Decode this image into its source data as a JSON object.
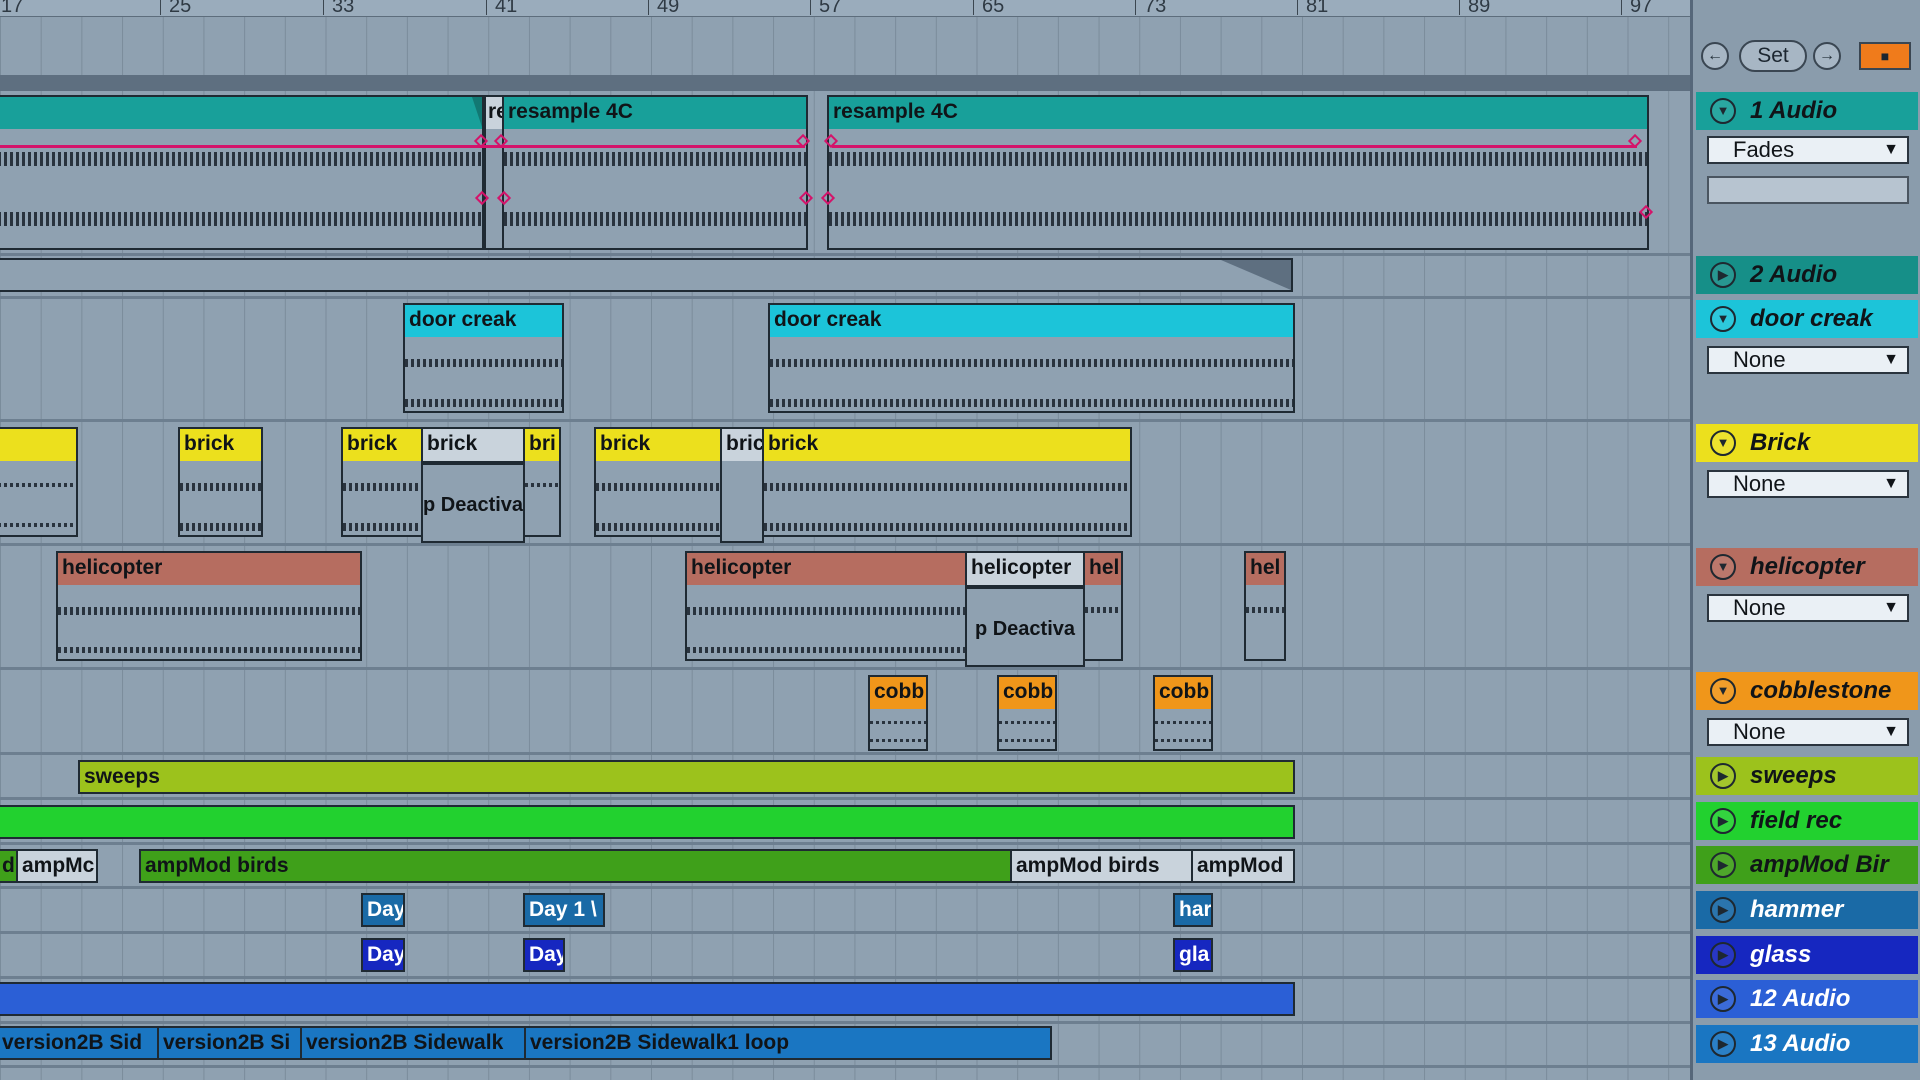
{
  "ruler": {
    "bars": [
      "17",
      "25",
      "33",
      "41",
      "49",
      "57",
      "65",
      "73",
      "81",
      "89",
      "97"
    ]
  },
  "transport": {
    "set_label": "Set",
    "prev_icon": "left-arrow-icon",
    "next_icon": "right-arrow-icon",
    "lock_icon": "lock-icon"
  },
  "tracks": [
    {
      "id": "t1",
      "name": "1 Audio",
      "color": "#18a09a",
      "expanded": true,
      "select": "Fades"
    },
    {
      "id": "t2",
      "name": "2 Audio",
      "color": "#168f88",
      "expanded": false
    },
    {
      "id": "t3",
      "name": "door creak",
      "color": "#1cc4d9",
      "expanded": true,
      "select": "None"
    },
    {
      "id": "t4",
      "name": "Brick",
      "color": "#ece01d",
      "expanded": true,
      "select": "None"
    },
    {
      "id": "t5",
      "name": "helicopter",
      "color": "#b66d60",
      "expanded": true,
      "select": "None"
    },
    {
      "id": "t6",
      "name": "cobblestone",
      "color": "#f0961a",
      "expanded": true,
      "select": "None"
    },
    {
      "id": "t7",
      "name": "sweeps",
      "color": "#9cc21c",
      "expanded": false
    },
    {
      "id": "t8",
      "name": "field rec",
      "color": "#22d12f",
      "expanded": false
    },
    {
      "id": "t9",
      "name": "ampMod Bir",
      "color": "#3fa01a",
      "expanded": false
    },
    {
      "id": "t10",
      "name": "hammer",
      "color": "#1a6aa6",
      "expanded": false
    },
    {
      "id": "t11",
      "name": "glass",
      "color": "#1627c0",
      "expanded": false
    },
    {
      "id": "t12",
      "name": "12 Audio",
      "color": "#2b5fd6",
      "expanded": false
    },
    {
      "id": "t13",
      "name": "13 Audio",
      "color": "#1a76c2",
      "expanded": false
    }
  ],
  "clips": {
    "t1": [
      "re",
      "resample 4C",
      "resample 4C"
    ],
    "t3": [
      "door creak",
      "door creak"
    ],
    "t4": [
      "brick",
      "brick",
      "brick",
      "bri",
      "brick",
      "bric",
      "brick"
    ],
    "t4_deact": "p Deactiva",
    "t5": [
      "helicopter",
      "helicopter",
      "helicopter",
      "hel",
      "hel"
    ],
    "t5_deact": "p Deactiva",
    "t6": [
      "cobb",
      "cobb",
      "cobb"
    ],
    "t7": [
      "sweeps"
    ],
    "t9": [
      "d",
      "ampMc",
      "ampMod birds",
      "ampMod birds",
      "ampMod"
    ],
    "t10": [
      "Day",
      "Day 1 \\",
      "har"
    ],
    "t11": [
      "Day",
      "Day",
      "gla"
    ],
    "t13": [
      "version2B Sid",
      "version2B Si",
      "version2B Sidewalk",
      "version2B Sidewalk1 loop"
    ]
  }
}
